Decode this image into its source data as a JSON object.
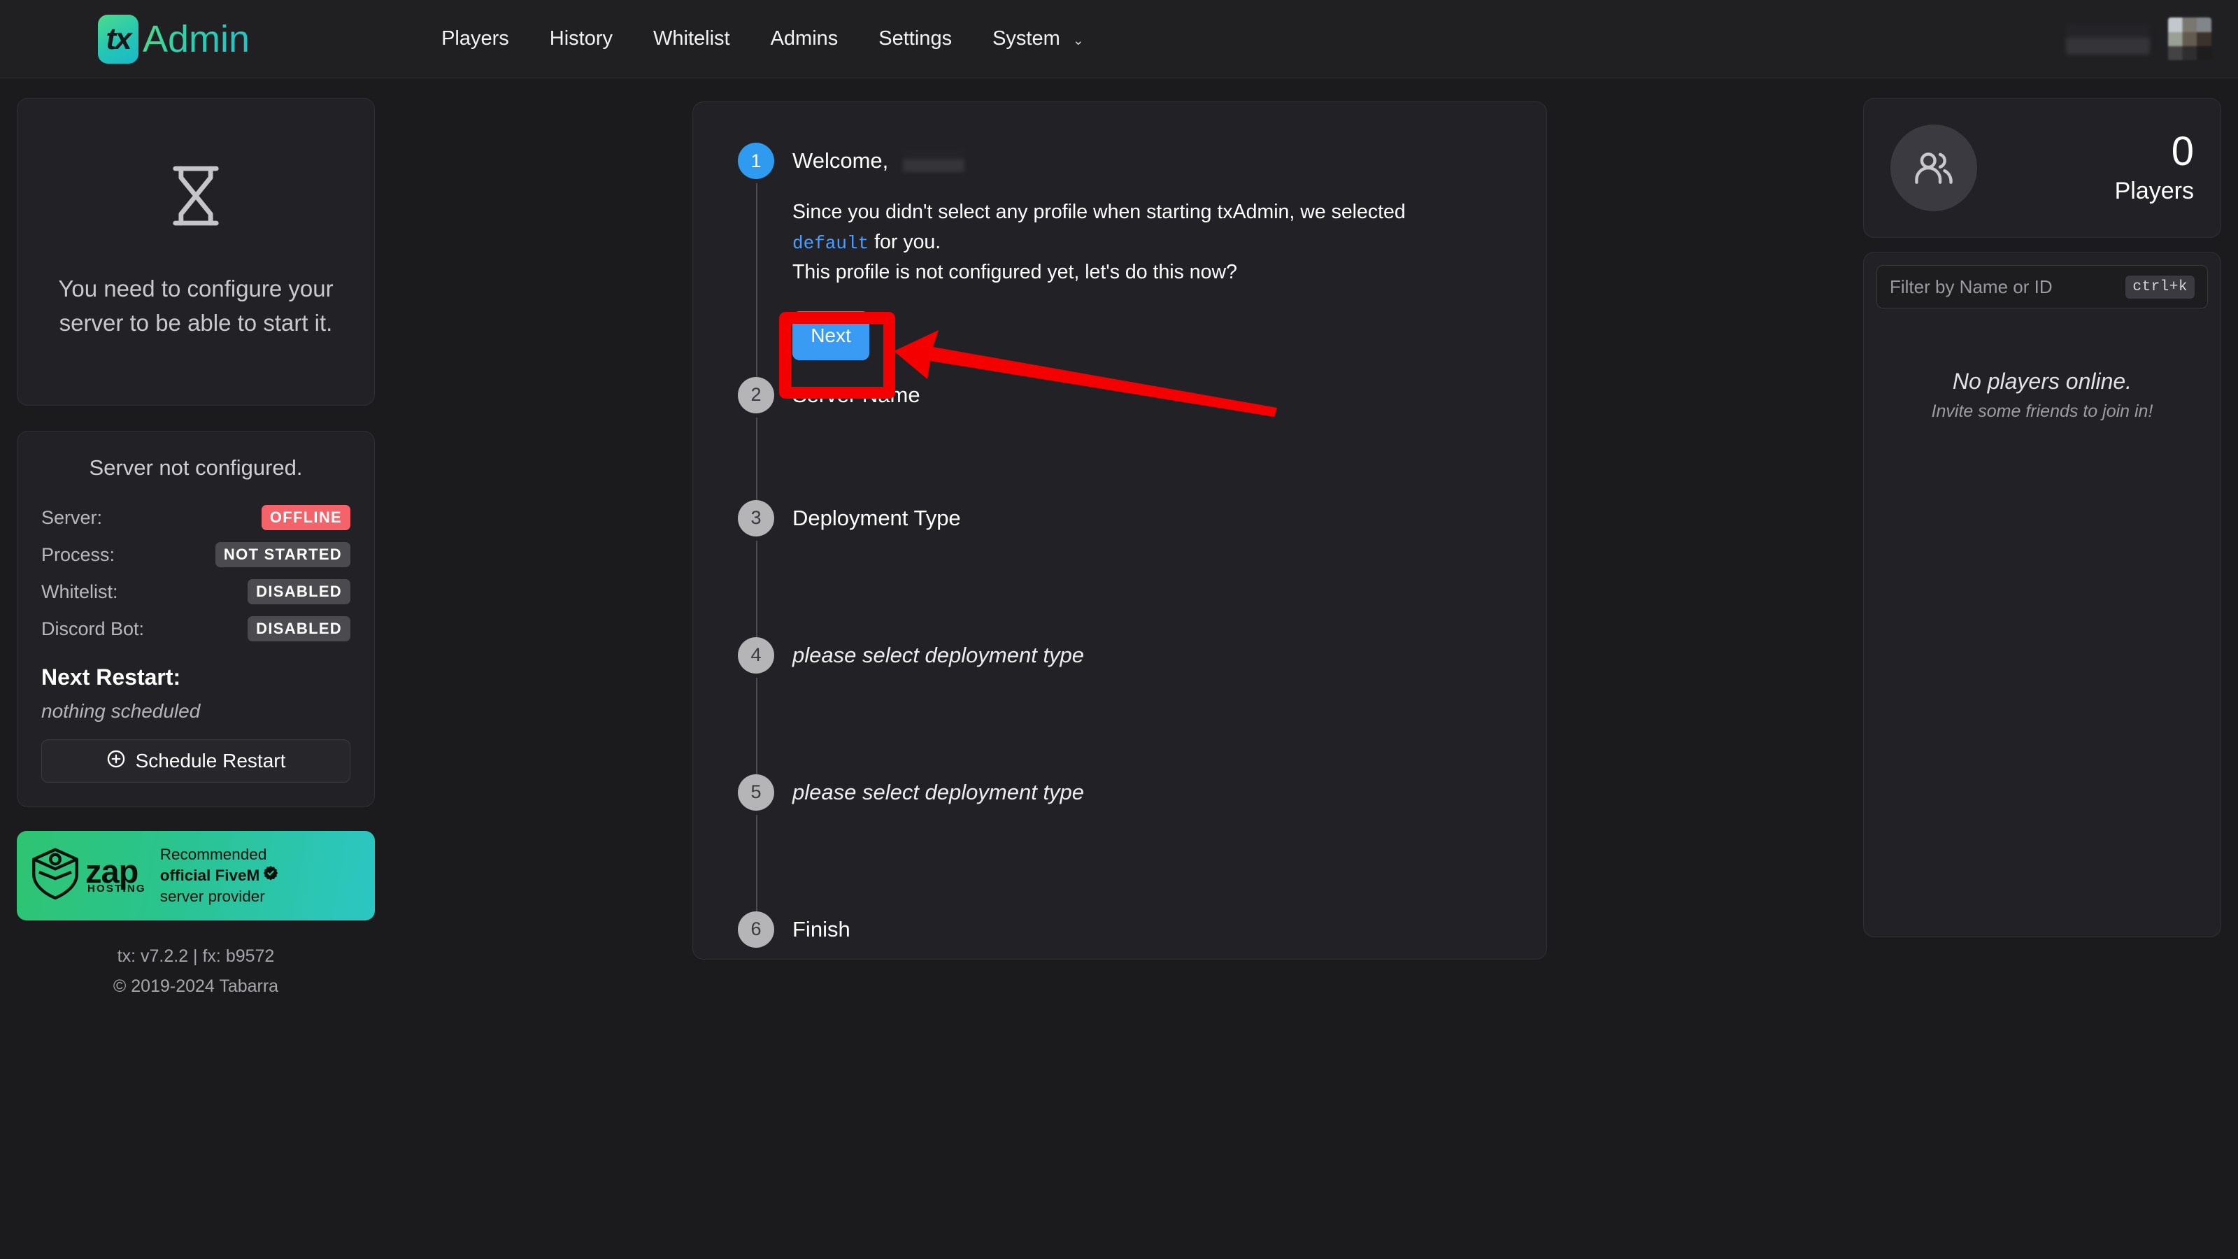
{
  "app": {
    "brand_mark": "tx",
    "brand_name": "Admin"
  },
  "nav": {
    "links": [
      {
        "label": "Players"
      },
      {
        "label": "History"
      },
      {
        "label": "Whitelist"
      },
      {
        "label": "Admins"
      },
      {
        "label": "Settings"
      },
      {
        "label": "System",
        "caret": "⌄"
      }
    ]
  },
  "configure_card": {
    "icon": "hourglass-icon",
    "message": "You need to configure your server to be able to start it."
  },
  "status_card": {
    "title": "Server not configured.",
    "rows": [
      {
        "label": "Server:",
        "value": "OFFLINE",
        "style": "offline"
      },
      {
        "label": "Process:",
        "value": "NOT STARTED",
        "style": "muted"
      },
      {
        "label": "Whitelist:",
        "value": "DISABLED",
        "style": "muted"
      },
      {
        "label": "Discord Bot:",
        "value": "DISABLED",
        "style": "muted"
      }
    ],
    "next_restart_label": "Next Restart:",
    "next_restart_value": "nothing scheduled",
    "schedule_button": "Schedule Restart",
    "schedule_icon": "plus-circle-icon"
  },
  "promo": {
    "logo_word": "zap",
    "logo_sub": "HOSTING",
    "line1": "Recommended",
    "line2": "official FiveM",
    "badge_icon": "verified-check-icon",
    "line3": "server provider"
  },
  "footer": {
    "versions": "tx: v7.2.2  |  fx: b9572",
    "copyright": "© 2019-2024 Tabarra"
  },
  "wizard": {
    "steps": [
      {
        "num": "1",
        "title": "Welcome,",
        "state": "active",
        "redacted": true
      },
      {
        "num": "2",
        "title": "Server Name",
        "state": "idle"
      },
      {
        "num": "3",
        "title": "Deployment Type",
        "state": "idle"
      },
      {
        "num": "4",
        "title": "please select deployment type",
        "state": "idle",
        "muted": true
      },
      {
        "num": "5",
        "title": "please select deployment type",
        "state": "idle",
        "muted": true
      },
      {
        "num": "6",
        "title": "Finish",
        "state": "idle"
      }
    ],
    "step1": {
      "line1_a": "Since you didn't select any profile when starting txAdmin, we selected",
      "code": "default",
      "line1_b": " for you.",
      "line2": "This profile is not configured yet, let's do this now?",
      "next_button": "Next"
    }
  },
  "players_panel": {
    "avatar_icon": "users-icon",
    "count": "0",
    "label": "Players",
    "filter_placeholder": "Filter by Name or ID",
    "filter_value": "",
    "shortcut": "ctrl+k",
    "empty_title": "No players online.",
    "empty_sub": "Invite some friends to join in!"
  },
  "annotation": {
    "color": "#f50000",
    "shape": "arrow-pointing-to-next-button"
  }
}
